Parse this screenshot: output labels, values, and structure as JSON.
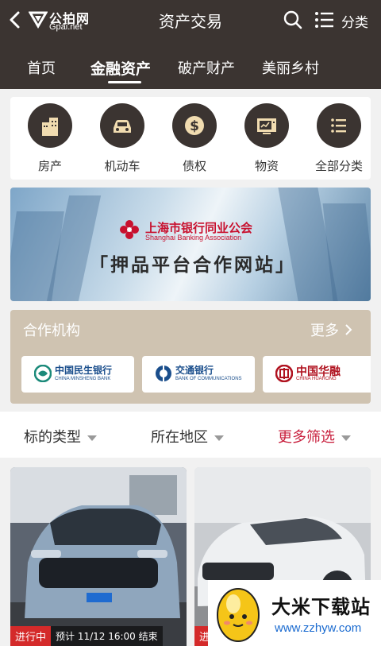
{
  "header": {
    "brand": "公拍网",
    "brand_sub": "Gpai.net",
    "title": "资产交易",
    "category_label": "分类"
  },
  "tabs": [
    {
      "label": "首页",
      "active": false
    },
    {
      "label": "金融资产",
      "active": true
    },
    {
      "label": "破产财产",
      "active": false
    },
    {
      "label": "美丽乡村",
      "active": false
    }
  ],
  "categories": [
    {
      "label": "房产",
      "icon": "building-icon"
    },
    {
      "label": "机动车",
      "icon": "car-icon"
    },
    {
      "label": "债权",
      "icon": "dollar-icon"
    },
    {
      "label": "物资",
      "icon": "monitor-icon"
    },
    {
      "label": "全部分类",
      "icon": "list-icon"
    }
  ],
  "banner": {
    "org_name": "上海市银行同业公会",
    "org_name_en": "Shanghai Banking Association",
    "slogan": "「押品平台合作网站」"
  },
  "partners": {
    "title": "合作机构",
    "more": "更多",
    "items": [
      {
        "name": "中国民生银行",
        "name_en": "CHINA MINSHENG BANK"
      },
      {
        "name": "交通银行",
        "name_en": "BANK OF COMMUNICATIONS"
      },
      {
        "name": "中国华融",
        "name_en": "CHINA HUARONG"
      }
    ]
  },
  "filters": [
    {
      "label": "标的类型"
    },
    {
      "label": "所在地区"
    },
    {
      "label": "更多筛选"
    }
  ],
  "listings": [
    {
      "status": "进行中",
      "time": "预计 11/12 16:00 结束"
    },
    {
      "status": "进"
    }
  ],
  "watermark": {
    "title": "大米下载站",
    "url": "www.zzhyw.com"
  },
  "colors": {
    "header_bg": "#3b3431",
    "accent_red": "#c81e3c",
    "partners_bg": "#cfc3b1"
  }
}
